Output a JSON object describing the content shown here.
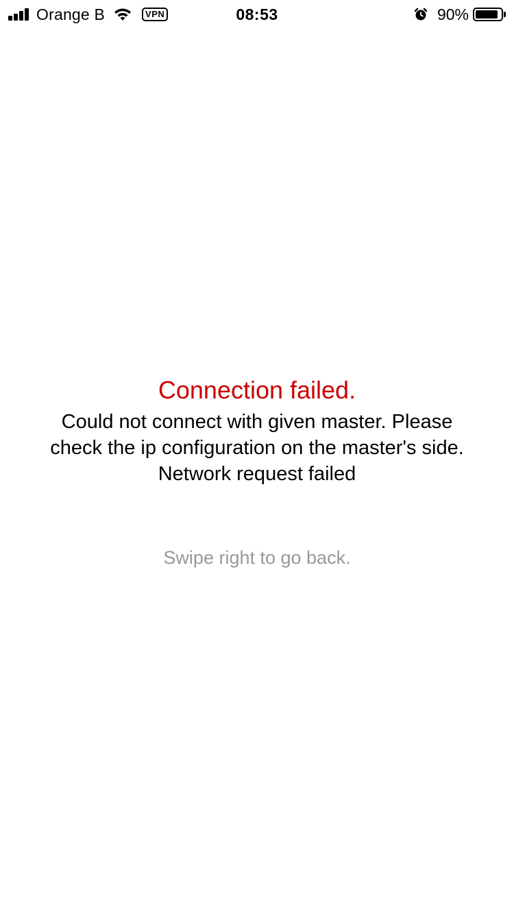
{
  "status_bar": {
    "carrier": "Orange B",
    "vpn_label": "VPN",
    "time": "08:53",
    "battery_percent": "90%",
    "battery_level": 0.9,
    "icons": [
      "signal-icon",
      "wifi-icon",
      "alarm-icon",
      "battery-icon"
    ]
  },
  "error": {
    "title": "Connection failed.",
    "detail": "Could not connect with given master. Please\ncheck the ip configuration on the master's side.\nNetwork request failed",
    "title_color": "#cc0000"
  },
  "hint": "Swipe right to go back."
}
